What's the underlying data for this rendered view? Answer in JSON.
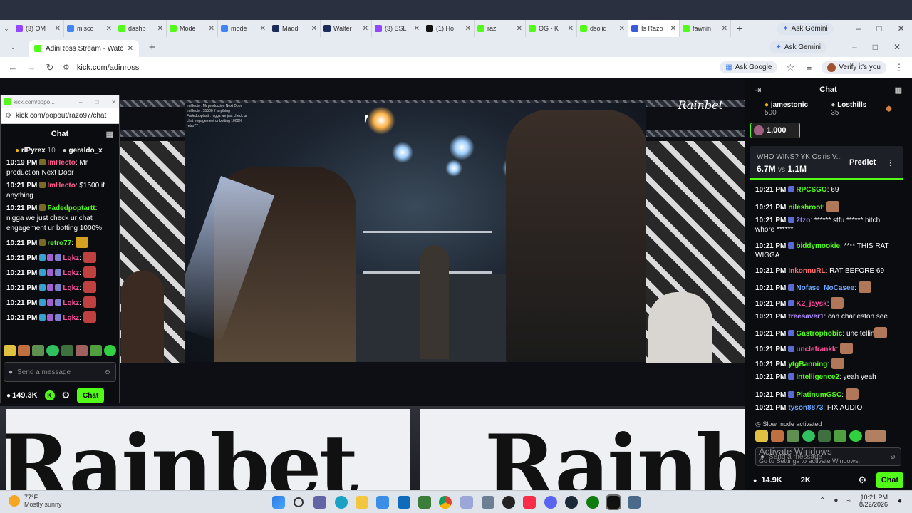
{
  "background_tabs": [
    {
      "label": "(3) OM",
      "color": "#9146ff"
    },
    {
      "label": "misco",
      "color": "#4285f4"
    },
    {
      "label": "dashb",
      "color": "#53fc18"
    },
    {
      "label": "Mode",
      "color": "#53fc18"
    },
    {
      "label": "mode",
      "color": "#4285f4"
    },
    {
      "label": "Madd",
      "color": "#1a2b5c"
    },
    {
      "label": "Walter",
      "color": "#1a2b5c"
    },
    {
      "label": "(3) ESL",
      "color": "#9146ff"
    },
    {
      "label": "(1) Ho",
      "color": "#111111"
    },
    {
      "label": "raz",
      "color": "#53fc18"
    },
    {
      "label": "OG - K",
      "color": "#53fc18"
    },
    {
      "label": "dsolid",
      "color": "#53fc18"
    },
    {
      "label": "Is Razo",
      "color": "#3b5bdb"
    },
    {
      "label": "fawnin",
      "color": "#53fc18"
    }
  ],
  "ask_gemini": "Ask Gemini",
  "main_tab": {
    "title": "AdinRoss Stream - Watch Live o"
  },
  "address": {
    "url": "kick.com/adinross",
    "ask_google": "Ask Google",
    "verify": "Verify it's you"
  },
  "popout": {
    "title": "kick.com/popo...",
    "url": "kick.com/popout/razo97/chat",
    "header": "Chat",
    "top_users": [
      {
        "name": "rIPyrex",
        "count": "10"
      },
      {
        "name": "geraldo_x",
        "count": ""
      }
    ],
    "messages": [
      {
        "time": "10:19 PM",
        "user": "ImHecto",
        "text": "Mr production Next Door",
        "color": "#ff5c8a"
      },
      {
        "time": "10:21 PM",
        "user": "ImHecto",
        "text": "$1500 if anything",
        "color": "#ff5c8a"
      },
      {
        "time": "10:21 PM",
        "user": "Fadedpoptartt",
        "text": "nigga we just check ur chat engagement ur botting 1000%",
        "color": "#53fc18"
      },
      {
        "time": "10:21 PM",
        "user": "retro77",
        "text": "",
        "color": "#53fc18"
      },
      {
        "time": "10:21 PM",
        "user": "Lqkz",
        "text": "",
        "color": "#ff4fa0"
      },
      {
        "time": "10:21 PM",
        "user": "Lqkz",
        "text": "",
        "color": "#ff4fa0"
      },
      {
        "time": "10:21 PM",
        "user": "Lqkz",
        "text": "",
        "color": "#ff4fa0"
      },
      {
        "time": "10:21 PM",
        "user": "Lqkz",
        "text": "",
        "color": "#ff4fa0"
      },
      {
        "time": "10:21 PM",
        "user": "Lqkz",
        "text": "",
        "color": "#ff4fa0"
      }
    ],
    "send_placeholder": "Send a message",
    "viewers": "149.3K",
    "chat_button": "Chat"
  },
  "stream": {
    "watermark": "Rainbet",
    "overlay_chat": [
      "ImHecto : Mr production Next Door",
      "ImHecto : $1500 if anything",
      "Fadedpoptartt : nigga we just check ur",
      "chat engagement ur botting 1000%",
      "retro77 :"
    ]
  },
  "right_chat": {
    "header": "Chat",
    "gifters": [
      {
        "name": "jamestonic",
        "count": "500"
      },
      {
        "name": "Losthills",
        "count": "35"
      }
    ],
    "goal": "1,000",
    "prediction": {
      "question": "WHO WINS? YK Osiris V...",
      "left": "6.7M",
      "vs": "vs",
      "right": "1.1M",
      "button": "Predict"
    },
    "messages": [
      {
        "time": "10:21 PM",
        "user": "RPCSGO",
        "text": "69",
        "color": "#53fc18"
      },
      {
        "time": "10:21 PM",
        "user": "nileshroot",
        "text": "",
        "color": "#53fc18"
      },
      {
        "time": "10:21 PM",
        "user": "2tzo",
        "text": "****** stfu ****** bitch whore ******",
        "color": "#8a7dff"
      },
      {
        "time": "10:21 PM",
        "user": "biddymookie",
        "text": "**** THIS RAT WIGGA",
        "color": "#53fc18"
      },
      {
        "time": "10:21 PM",
        "user": "InkonnuRL",
        "text": "RAT BEFORE 69",
        "color": "#ff6b6b"
      },
      {
        "time": "10:21 PM",
        "user": "Nofase_NoCasee",
        "text": "",
        "color": "#6fa8ff"
      },
      {
        "time": "10:21 PM",
        "user": "K2_jaysk",
        "text": "",
        "color": "#ff4fa0"
      },
      {
        "time": "10:21 PM",
        "user": "treesaver1",
        "text": "can charleston see",
        "color": "#b08cff"
      },
      {
        "time": "10:21 PM",
        "user": "Gastrophobic",
        "text": "unc tellin",
        "color": "#53fc18"
      },
      {
        "time": "10:21 PM",
        "user": "unclefrankk",
        "text": "",
        "color": "#ff4fa0"
      },
      {
        "time": "10:21 PM",
        "user": "ytgBanning",
        "text": "",
        "color": "#53fc18"
      },
      {
        "time": "10:21 PM",
        "user": "Intelligence2",
        "text": "yeah yeah",
        "color": "#53fc18"
      },
      {
        "time": "10:21 PM",
        "user": "PlatinumGSC",
        "text": "",
        "color": "#53fc18"
      },
      {
        "time": "10:21 PM",
        "user": "tyson8873",
        "text": "FIX AUDIO",
        "color": "#6fa8ff"
      }
    ],
    "slow_mode": "Slow mode activated",
    "send_placeholder": "Send a message",
    "activate_title": "Activate Windows",
    "activate_sub": "Go to Settings to activate Windows.",
    "viewers": "14.9K",
    "likes": "2K",
    "chat_button": "Chat"
  },
  "taskbar": {
    "weather_temp": "77°F",
    "weather_desc": "Mostly sunny",
    "time": "10:21 PM",
    "date": "8/22/2026"
  }
}
